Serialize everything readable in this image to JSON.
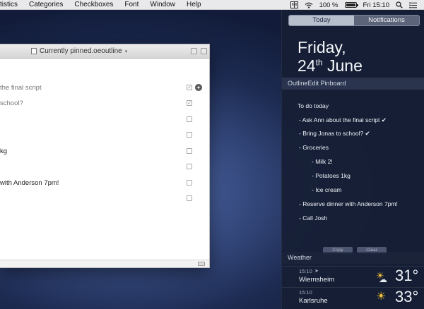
{
  "menubar": {
    "menus": [
      "tistics",
      "Categories",
      "Checkboxes",
      "Font",
      "Window",
      "Help"
    ],
    "battery_text": "100 %",
    "battery_level": 1.0,
    "clock": "Fri 15:10",
    "icons": [
      "notes-icon",
      "wifi-icon",
      "battery-icon",
      "search-icon",
      "list-icon"
    ]
  },
  "editor": {
    "window_title": "Currently pinned.oeoutline",
    "rows": [
      {
        "text": "the final script",
        "checked": true,
        "dim": true
      },
      {
        "text": "school?",
        "checked": true,
        "dim": true
      },
      {
        "text": "",
        "checked": false
      },
      {
        "text": "",
        "checked": false
      },
      {
        "text": "kg",
        "checked": false
      },
      {
        "text": "",
        "checked": false
      },
      {
        "text": "with Anderson 7pm!",
        "checked": false
      },
      {
        "text": "",
        "checked": false
      }
    ]
  },
  "notification_center": {
    "tabs": [
      "Today",
      "Notifications"
    ],
    "active_tab": "Today",
    "date_line1": "Friday,",
    "date_day": "24",
    "date_suffix": "th",
    "date_month": " June",
    "pinboard": {
      "header": "OutlineEdit Pinboard",
      "lines": [
        "To do today",
        "- Ask Ann about the final script  ✔",
        "- Bring Jonas to school?  ✔",
        "- Groceries",
        "- Milk 2!",
        "- Potatoes 1kg",
        "- Ice cream",
        "- Reserve dinner with Anderson 7pm!",
        "- Call Josh"
      ],
      "copy_label": "Copy",
      "clear_label": "Clear"
    },
    "weather": {
      "header": "Weather",
      "cities": [
        {
          "time": "15:10",
          "city": "Wiernsheim",
          "temp": "31°",
          "icon": "partly-cloudy-icon"
        },
        {
          "time": "15:10",
          "city": "Karlsruhe",
          "temp": "33°",
          "icon": "sun-icon"
        }
      ]
    }
  }
}
